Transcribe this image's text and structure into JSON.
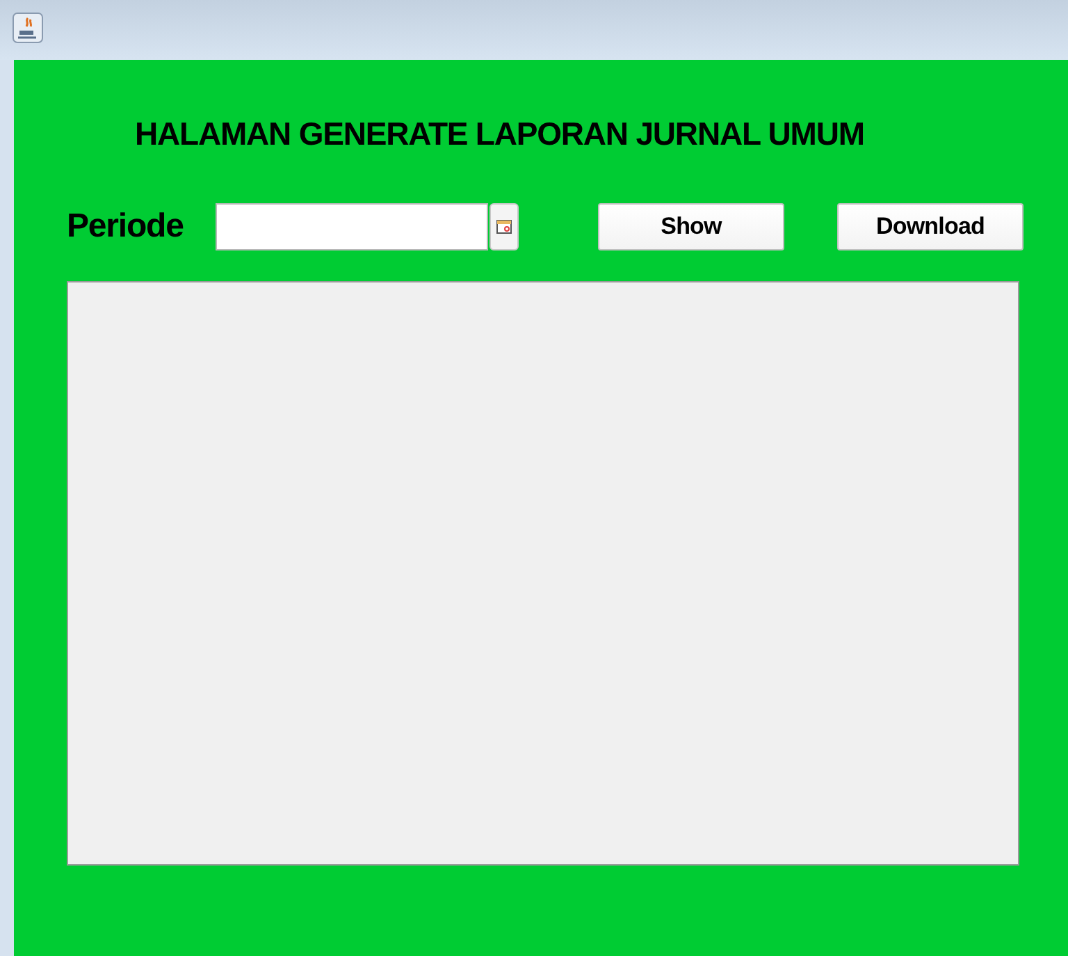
{
  "heading": "HALAMAN GENERATE LAPORAN JURNAL UMUM",
  "period": {
    "label": "Periode"
  },
  "buttons": [
    "Show",
    "Download"
  ]
}
